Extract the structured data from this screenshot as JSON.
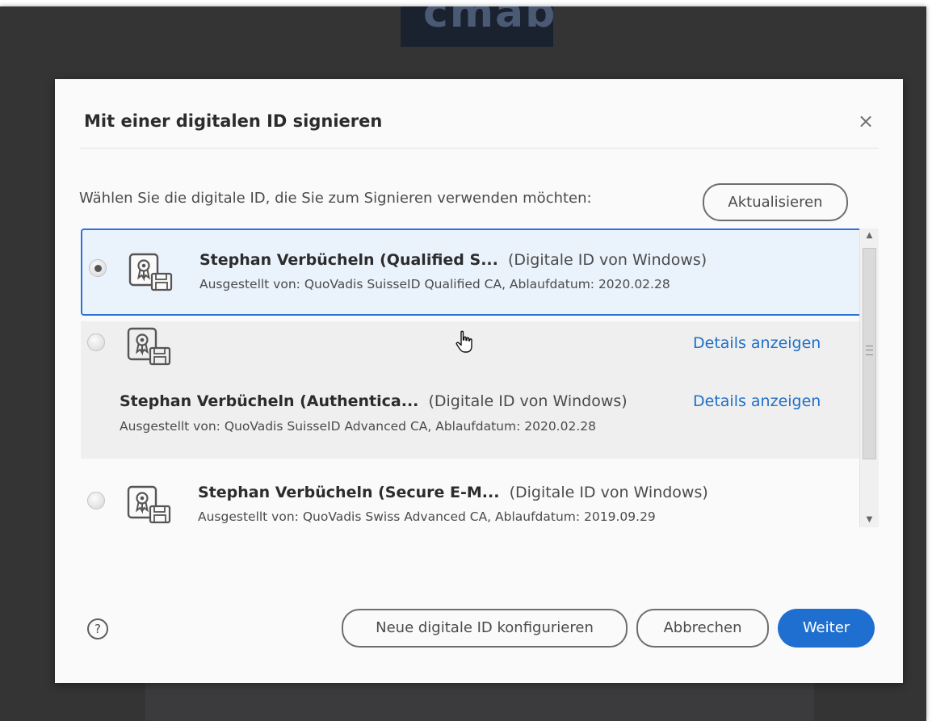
{
  "background": {
    "document_header_text": "cmab"
  },
  "dialog": {
    "title": "Mit einer digitalen ID signieren",
    "close_label": "×",
    "prompt": "Wählen Sie die digitale ID, die Sie zum Signieren verwenden möchten:",
    "refresh_label": "Aktualisieren"
  },
  "ids": [
    {
      "name": "Stephan Verbücheln (Qualified S...",
      "source": "(Digitale ID von Windows)",
      "issuer": "Ausgestellt von: QuoVadis SuisseID Qualified CA, Ablaufdatum: 2020.02.28",
      "selected": true
    },
    {
      "name": "Stephan Verbücheln (Authentica...",
      "source": "(Digitale ID von Windows)",
      "issuer": "Ausgestellt von: QuoVadis SuisseID Advanced CA, Ablaufdatum: 2020.02.28",
      "details_label": "Details anzeigen",
      "selected": false
    },
    {
      "name": "Stephan Verbücheln (Secure E-M...",
      "source": "(Digitale ID von Windows)",
      "issuer": "Ausgestellt von: QuoVadis Swiss Advanced CA, Ablaufdatum: 2019.09.29",
      "selected": false
    }
  ],
  "footer": {
    "help_label": "?",
    "new_id_label": "Neue digitale ID konfigurieren",
    "cancel_label": "Abbrechen",
    "next_label": "Weiter"
  },
  "icons": {
    "certificate": "certificate-icon",
    "close": "close-icon",
    "help": "help-icon",
    "cursor": "hand-cursor-icon"
  },
  "colors": {
    "primary": "#1f6fd0",
    "link": "#1f6fc9",
    "selection_border": "#2d74da",
    "selection_fill": "#eaf2fc"
  }
}
